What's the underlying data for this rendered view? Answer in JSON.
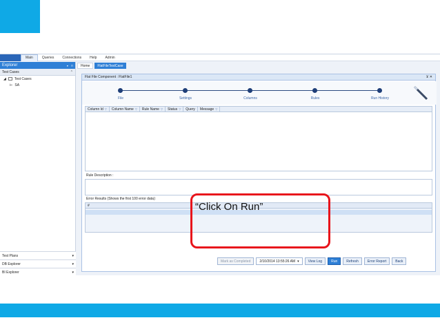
{
  "menu": {
    "items": [
      "Main",
      "Queries",
      "Connections",
      "Help",
      "Admin"
    ],
    "active": "Main"
  },
  "sidebar": {
    "title": "Explorer",
    "section": "Test Cases",
    "tree": {
      "root": "Test Cases",
      "child": "SA"
    },
    "bottom_items": [
      "Test Plans",
      "DB Explorer",
      "BI Explorer"
    ]
  },
  "tabs": {
    "home": "Home",
    "active": "FlatFileTestCase"
  },
  "panel": {
    "title": "Flat File Component : FlatFile1",
    "steps": [
      "File",
      "Settings",
      "Columns",
      "Rules",
      "Run History"
    ],
    "columns": [
      "Column Id",
      "Column Name",
      "Rule Name",
      "Status",
      "Query",
      "Message"
    ],
    "rule_description_label": "Rule Description :",
    "error_results_label": "Error Results (Shows the first 100 error data):",
    "error_grid_header": "#"
  },
  "bottom_bar": {
    "mark_completed": "Mark as Completed",
    "datetime": "2/10/2014 13:55:26 AM",
    "view_log": "View Log",
    "run": "Run",
    "refresh": "Refresh",
    "error_report": "Error Report",
    "back": "Back"
  },
  "callout": {
    "text": "“Click On Run”"
  },
  "colors": {
    "accent": "#0fa9e6",
    "callout_border": "#e8141b",
    "primary": "#2e7fd6"
  }
}
